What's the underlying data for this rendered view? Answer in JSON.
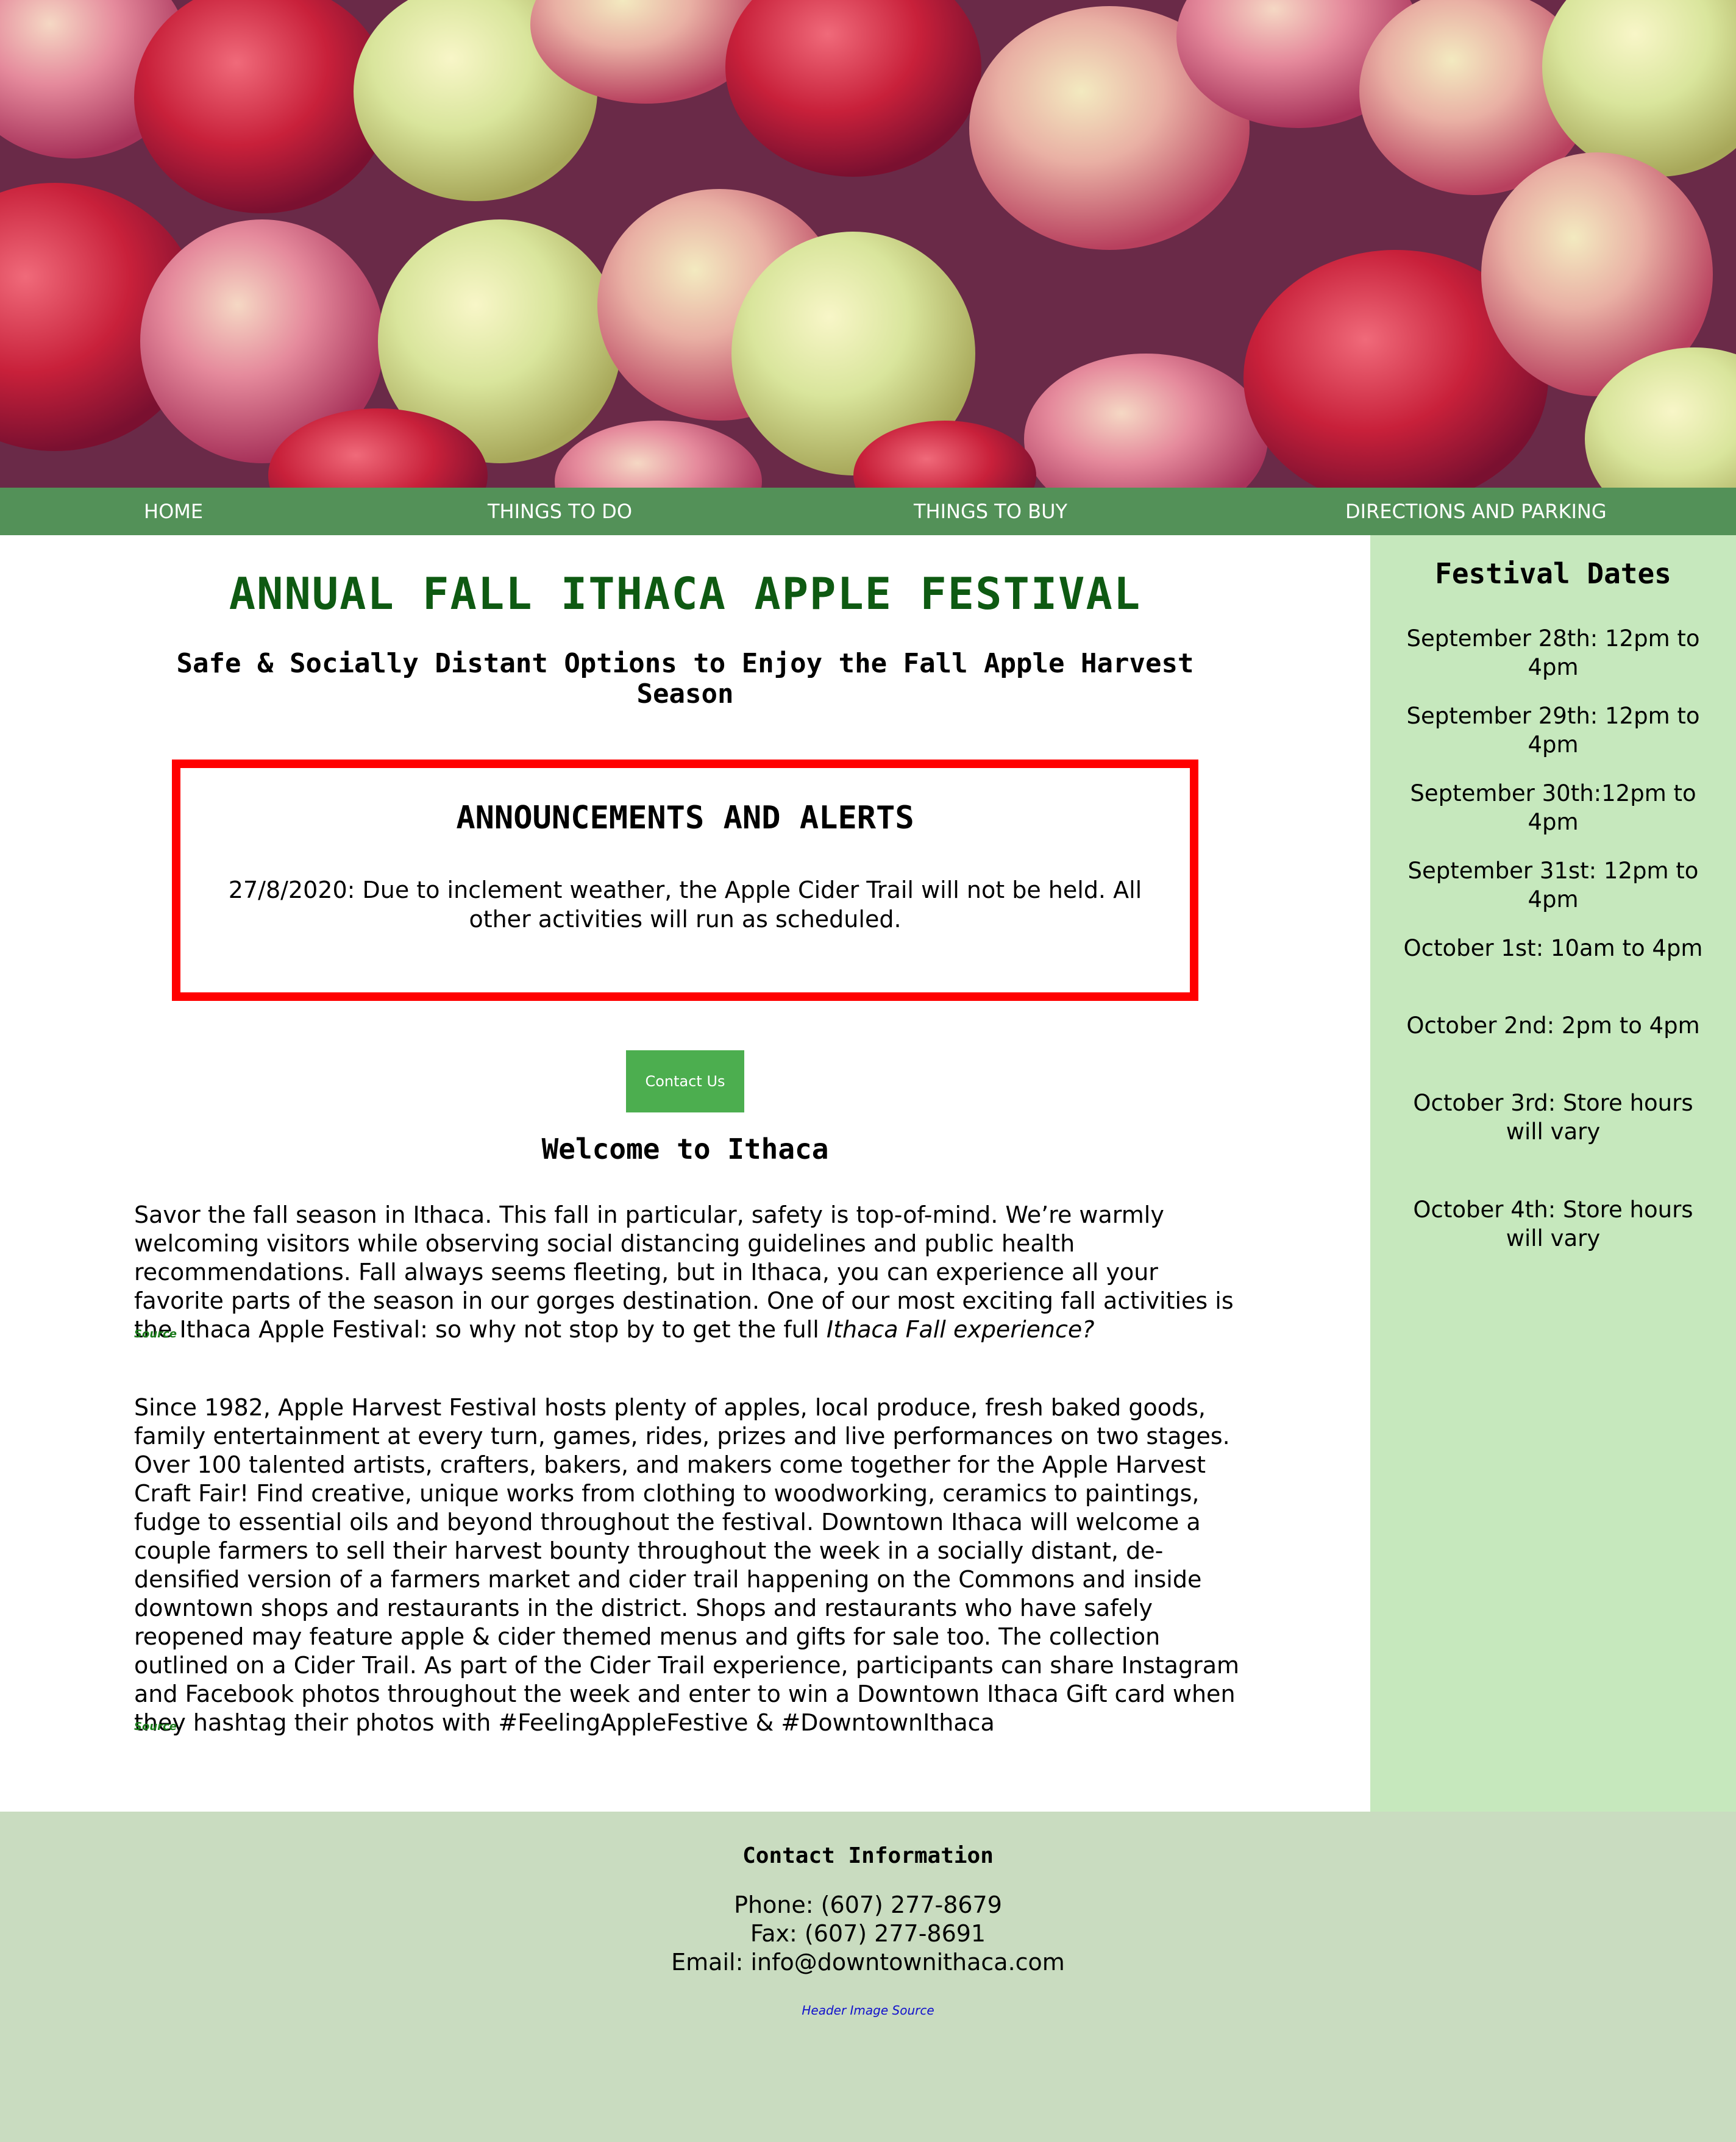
{
  "nav": {
    "items": [
      {
        "label": "HOME"
      },
      {
        "label": "THINGS TO DO"
      },
      {
        "label": "THINGS TO BUY"
      },
      {
        "label": "DIRECTIONS AND PARKING"
      }
    ]
  },
  "main": {
    "title": "ANNUAL FALL ITHACA APPLE FESTIVAL",
    "subtitle": "Safe & Socially Distant Options to Enjoy the Fall Apple Harvest Season",
    "alerts": {
      "title": "ANNOUNCEMENTS AND ALERTS",
      "text": "27/8/2020: Due to inclement weather, the Apple Cider Trail will not be held. All other activities will run as scheduled."
    },
    "contact_button": "Contact Us",
    "welcome_heading": "Welcome to Ithaca",
    "paragraph1": "Savor the fall season in Ithaca. This fall in particular, safety is top-of-mind. We’re warmly welcoming visitors while observing social distancing guidelines and public health recommendations. Fall always seems fleeting, but in Ithaca, you can experience all your favorite parts of the season in our gorges destination. One of our most exciting fall activities is the Ithaca Apple Festival: so why not stop by to get the full ",
    "paragraph1_italic": "Ithaca Fall experience?",
    "source1": "Source",
    "paragraph2": "Since 1982, Apple Harvest Festival hosts plenty of apples, local produce, fresh baked goods, family entertainment at every turn, games, rides, prizes and live performances on two stages. Over 100 talented artists, crafters, bakers, and makers come together for the Apple Harvest Craft Fair! Find creative, unique works from clothing to woodworking, ceramics to paintings, fudge to essential oils and beyond throughout the festival. Downtown Ithaca will welcome a couple farmers to sell their harvest bounty throughout the week in a socially distant, de-densified version of a farmers market and cider trail happening on the Commons and inside downtown shops and restaurants in the district. Shops and restaurants who have safely reopened may feature apple & cider themed menus and gifts for sale too. The collection outlined on a Cider Trail. As part of the Cider Trail experience, participants can share Instagram and Facebook photos throughout the week and enter to win a Downtown Ithaca Gift card when they hashtag their photos with #FeelingAppleFestive & #DowntownIthaca",
    "source2": "Source"
  },
  "sidebar": {
    "title": "Festival Dates",
    "dates": [
      "September 28th: 12pm to 4pm",
      "September 29th: 12pm to 4pm",
      "September 30th:12pm to 4pm",
      "September 31st: 12pm to 4pm",
      "October 1st: 10am to 4pm",
      "October 2nd: 2pm to 4pm",
      "October 3rd: Store hours will vary",
      "October 4th: Store hours will vary"
    ]
  },
  "footer": {
    "title": "Contact Information",
    "phone": "Phone: (607) 277-8679",
    "fax": "Fax: (607) 277-8691",
    "email": "Email: info@downtownithaca.com",
    "image_source": "Header Image Source"
  },
  "colors": {
    "nav_bg": "#539158",
    "title_green": "#0e5a12",
    "alert_border": "#ff0000",
    "button_green": "#4cae4f",
    "sidebar_bg": "#c6e8bd",
    "footer_bg": "#c9dcc0",
    "source_link": "#1a7a1a",
    "image_source_link": "#1111cc"
  },
  "hero_image": {
    "alt": "apples"
  }
}
